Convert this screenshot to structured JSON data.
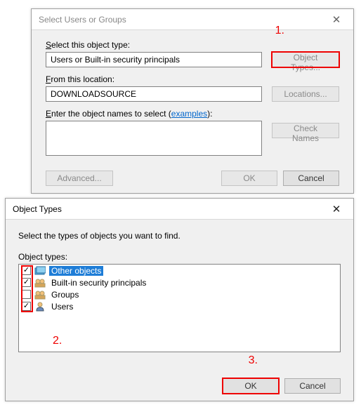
{
  "annotations": {
    "a1": "1.",
    "a2": "2.",
    "a3": "3."
  },
  "dialog1": {
    "title": "Select Users or Groups",
    "objectTypeLabel_pre": "S",
    "objectTypeLabel_rest": "elect this object type:",
    "objectTypeValue": "Users or Built-in security principals",
    "objectTypesBtn": "Object Types...",
    "fromLabel_pre": "F",
    "fromLabel_rest": "rom this location:",
    "fromValue": "DOWNLOADSOURCE",
    "locationsBtn": "Locations...",
    "enterLabel_pre": "E",
    "enterLabel_mid": "nter the object names to select (",
    "enterLabel_link": "examples",
    "enterLabel_post": "):",
    "checkNamesBtn": "Check Names",
    "advancedBtn": "Advanced...",
    "okBtn": "OK",
    "cancelBtn": "Cancel"
  },
  "dialog2": {
    "title": "Object Types",
    "instruction": "Select the types of objects you want to find.",
    "listLabel": "Object types:",
    "items": [
      {
        "label": "Other objects",
        "checked": true,
        "selected": true,
        "icon": "cube"
      },
      {
        "label": "Built-in security principals",
        "checked": true,
        "selected": false,
        "icon": "group"
      },
      {
        "label": "Groups",
        "checked": false,
        "selected": false,
        "icon": "group"
      },
      {
        "label": "Users",
        "checked": true,
        "selected": false,
        "icon": "user"
      }
    ],
    "okBtn": "OK",
    "cancelBtn": "Cancel"
  }
}
